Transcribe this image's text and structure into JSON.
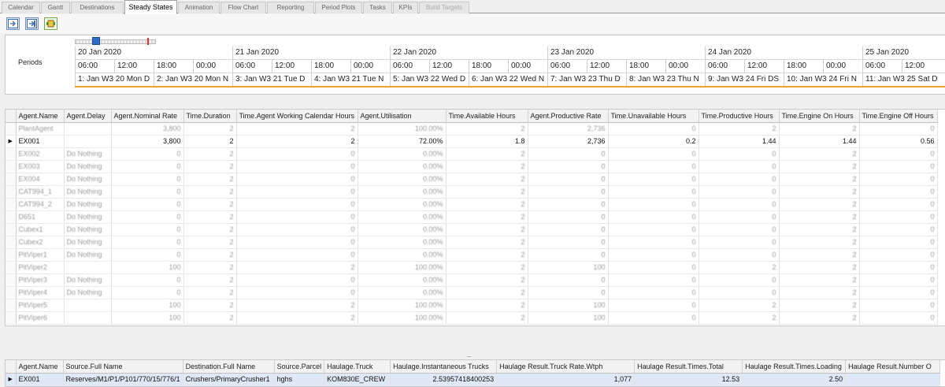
{
  "tabs": [
    {
      "label": "Calendar",
      "state": "normal"
    },
    {
      "label": "Gantt",
      "state": "normal"
    },
    {
      "label": "Destinations",
      "state": "normal"
    },
    {
      "label": "Steady States",
      "state": "active"
    },
    {
      "label": "Animation",
      "state": "normal"
    },
    {
      "label": "Flow Chart",
      "state": "normal"
    },
    {
      "label": "Reporting",
      "state": "normal"
    },
    {
      "label": "Period Plots",
      "state": "normal"
    },
    {
      "label": "Tasks",
      "state": "normal"
    },
    {
      "label": "KPIs",
      "state": "normal"
    },
    {
      "label": "Build Targets",
      "state": "disabled"
    }
  ],
  "toolbar": {
    "buttons": [
      {
        "icon": "export-left-icon"
      },
      {
        "icon": "export-right-icon"
      },
      {
        "icon": "settings-robot-icon"
      }
    ]
  },
  "timeline": {
    "label": "Periods",
    "days": [
      "20 Jan 2020",
      "21 Jan 2020",
      "22 Jan 2020",
      "23 Jan 2020",
      "24 Jan 2020",
      "25 Jan 2020"
    ],
    "hours": [
      "06:00",
      "12:00",
      "18:00",
      "00:00",
      "06:00",
      "12:00",
      "18:00",
      "00:00",
      "06:00",
      "12:00",
      "18:00",
      "00:00",
      "06:00",
      "12:00",
      "18:00",
      "00:00",
      "06:00",
      "12:00",
      "18:00",
      "00:00",
      "06:00",
      "12:00"
    ],
    "periods": [
      "1: Jan W3 20 Mon D",
      "2: Jan W3 20 Mon N",
      "3: Jan W3 21 Tue D",
      "4: Jan W3 21 Tue N",
      "5: Jan W3 22 Wed D",
      "6: Jan W3 22 Wed N",
      "7: Jan W3 23 Thu D",
      "8: Jan W3 23 Thu N",
      "9: Jan W3 24 Fri DS",
      "10: Jan W3 24 Fri N",
      "11: Jan W3 25 Sat D"
    ]
  },
  "agents_grid": {
    "columns": [
      "Agent.Name",
      "Agent.Delay",
      "Agent.Nominal Rate",
      "Time.Duration",
      "Time.Agent Working Calendar Hours",
      "Agent.Utilisation",
      "Time.Available Hours",
      "Agent.Productive Rate",
      "Time.Unavailable Hours",
      "Time.Productive Hours",
      "Time.Engine On Hours",
      "Time.Engine Off Hours"
    ],
    "rows": [
      {
        "cells": [
          "PlantAgent",
          "",
          "3,800",
          "2",
          "2",
          "100.00%",
          "2",
          "2,736",
          "0",
          "2",
          "2",
          "0"
        ]
      },
      {
        "cells": [
          "EX001",
          "",
          "3,800",
          "2",
          "2",
          "72.00%",
          "1.8",
          "2,736",
          "0.2",
          "1.44",
          "1.44",
          "0.56"
        ],
        "selected": true
      },
      {
        "cells": [
          "EX002",
          "Do Nothing",
          "0",
          "2",
          "0",
          "0.00%",
          "2",
          "0",
          "0",
          "0",
          "2",
          "0"
        ]
      },
      {
        "cells": [
          "EX003",
          "Do Nothing",
          "0",
          "2",
          "0",
          "0.00%",
          "2",
          "0",
          "0",
          "0",
          "2",
          "0"
        ]
      },
      {
        "cells": [
          "EX004",
          "Do Nothing",
          "0",
          "2",
          "0",
          "0.00%",
          "2",
          "0",
          "0",
          "0",
          "2",
          "0"
        ]
      },
      {
        "cells": [
          "CAT994_1",
          "Do Nothing",
          "0",
          "2",
          "0",
          "0.00%",
          "2",
          "0",
          "0",
          "0",
          "2",
          "0"
        ]
      },
      {
        "cells": [
          "CAT994_2",
          "Do Nothing",
          "0",
          "2",
          "0",
          "0.00%",
          "2",
          "0",
          "0",
          "0",
          "2",
          "0"
        ]
      },
      {
        "cells": [
          "D651",
          "Do Nothing",
          "0",
          "2",
          "0",
          "0.00%",
          "2",
          "0",
          "0",
          "0",
          "2",
          "0"
        ]
      },
      {
        "cells": [
          "Cubex1",
          "Do Nothing",
          "0",
          "2",
          "0",
          "0.00%",
          "2",
          "0",
          "0",
          "0",
          "2",
          "0"
        ]
      },
      {
        "cells": [
          "Cubex2",
          "Do Nothing",
          "0",
          "2",
          "0",
          "0.00%",
          "2",
          "0",
          "0",
          "0",
          "2",
          "0"
        ]
      },
      {
        "cells": [
          "PitViper1",
          "Do Nothing",
          "0",
          "2",
          "0",
          "0.00%",
          "2",
          "0",
          "0",
          "0",
          "2",
          "0"
        ]
      },
      {
        "cells": [
          "PitViper2",
          "",
          "100",
          "2",
          "2",
          "100.00%",
          "2",
          "100",
          "0",
          "2",
          "2",
          "0"
        ]
      },
      {
        "cells": [
          "PitViper3",
          "Do Nothing",
          "0",
          "2",
          "0",
          "0.00%",
          "2",
          "0",
          "0",
          "0",
          "2",
          "0"
        ]
      },
      {
        "cells": [
          "PitViper4",
          "Do Nothing",
          "0",
          "2",
          "0",
          "0.00%",
          "2",
          "0",
          "0",
          "0",
          "2",
          "0"
        ]
      },
      {
        "cells": [
          "PitViper5",
          "",
          "100",
          "2",
          "2",
          "100.00%",
          "2",
          "100",
          "0",
          "2",
          "2",
          "0"
        ]
      },
      {
        "cells": [
          "PitViper6",
          "",
          "100",
          "2",
          "2",
          "100.00%",
          "2",
          "100",
          "0",
          "2",
          "2",
          "0"
        ]
      }
    ]
  },
  "haulage_grid": {
    "columns": [
      "Agent.Name",
      "Source.Full Name",
      "Destination.Full Name",
      "Source.Parcel",
      "Haulage.Truck",
      "Haulage.Instantaneous Trucks",
      "Haulage Result.Truck Rate.Wtph",
      "Haulage Result.Times.Total",
      "Haulage Result.Times.Loading",
      "Haulage Result.Number O"
    ],
    "rows": [
      {
        "cells": [
          "EX001",
          "Reserves/M1/P1/P101/770/15/776/1",
          "Crushers/PrimaryCrusher1",
          "hghs",
          "KOM830E_CREW",
          "2.53957418400253",
          "1,077",
          "12.53",
          "2.50",
          ""
        ]
      }
    ]
  },
  "splitter": {
    "grip": "....."
  }
}
